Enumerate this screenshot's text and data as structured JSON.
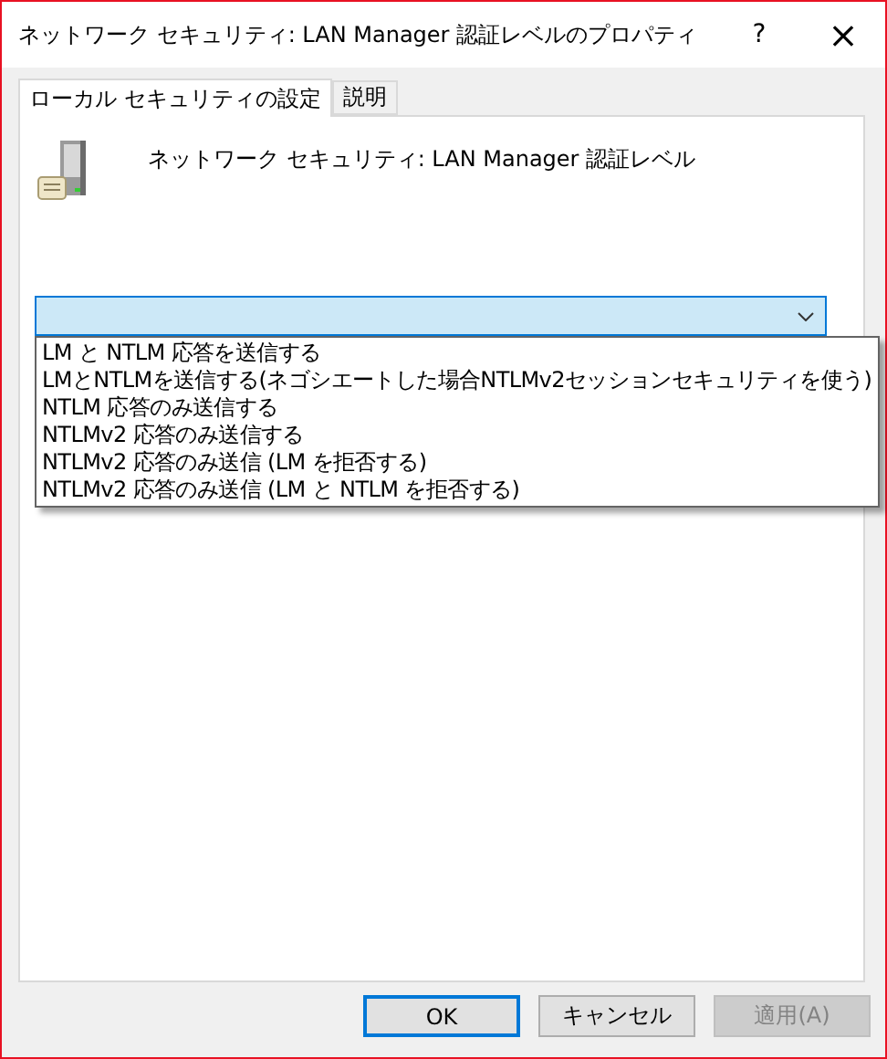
{
  "window": {
    "title": "ネットワーク セキュリティ: LAN Manager 認証レベルのプロパティ",
    "help": "?",
    "close": "×"
  },
  "tabs": [
    {
      "label": "ローカル セキュリティの設定",
      "selected": true
    },
    {
      "label": "説明",
      "selected": false
    }
  ],
  "policy": {
    "name": "ネットワーク セキュリティ: LAN Manager 認証レベル"
  },
  "dropdown": {
    "expanded": true,
    "options": [
      {
        "label": "LM と NTLM 応答を送信する",
        "selected": false
      },
      {
        "label": "LMとNTLMを送信する(ネゴシエートした場合NTLMv2セッションセキュリティを使う)",
        "selected": false
      },
      {
        "label": "NTLM 応答のみ送信する",
        "selected": false
      },
      {
        "label": "NTLMv2 応答のみ送信する",
        "selected": false
      },
      {
        "label": "NTLMv2 応答のみ送信 (LM を拒否する)",
        "selected": false
      },
      {
        "label": "NTLMv2 応答のみ送信 (LM と NTLM を拒否する)",
        "selected": false
      }
    ]
  },
  "buttons": [
    {
      "label": "OK",
      "default": true,
      "disabled": false
    },
    {
      "label": "キャンセル",
      "default": false,
      "disabled": false
    },
    {
      "label": "適用(A)",
      "default": false,
      "disabled": true
    }
  ]
}
